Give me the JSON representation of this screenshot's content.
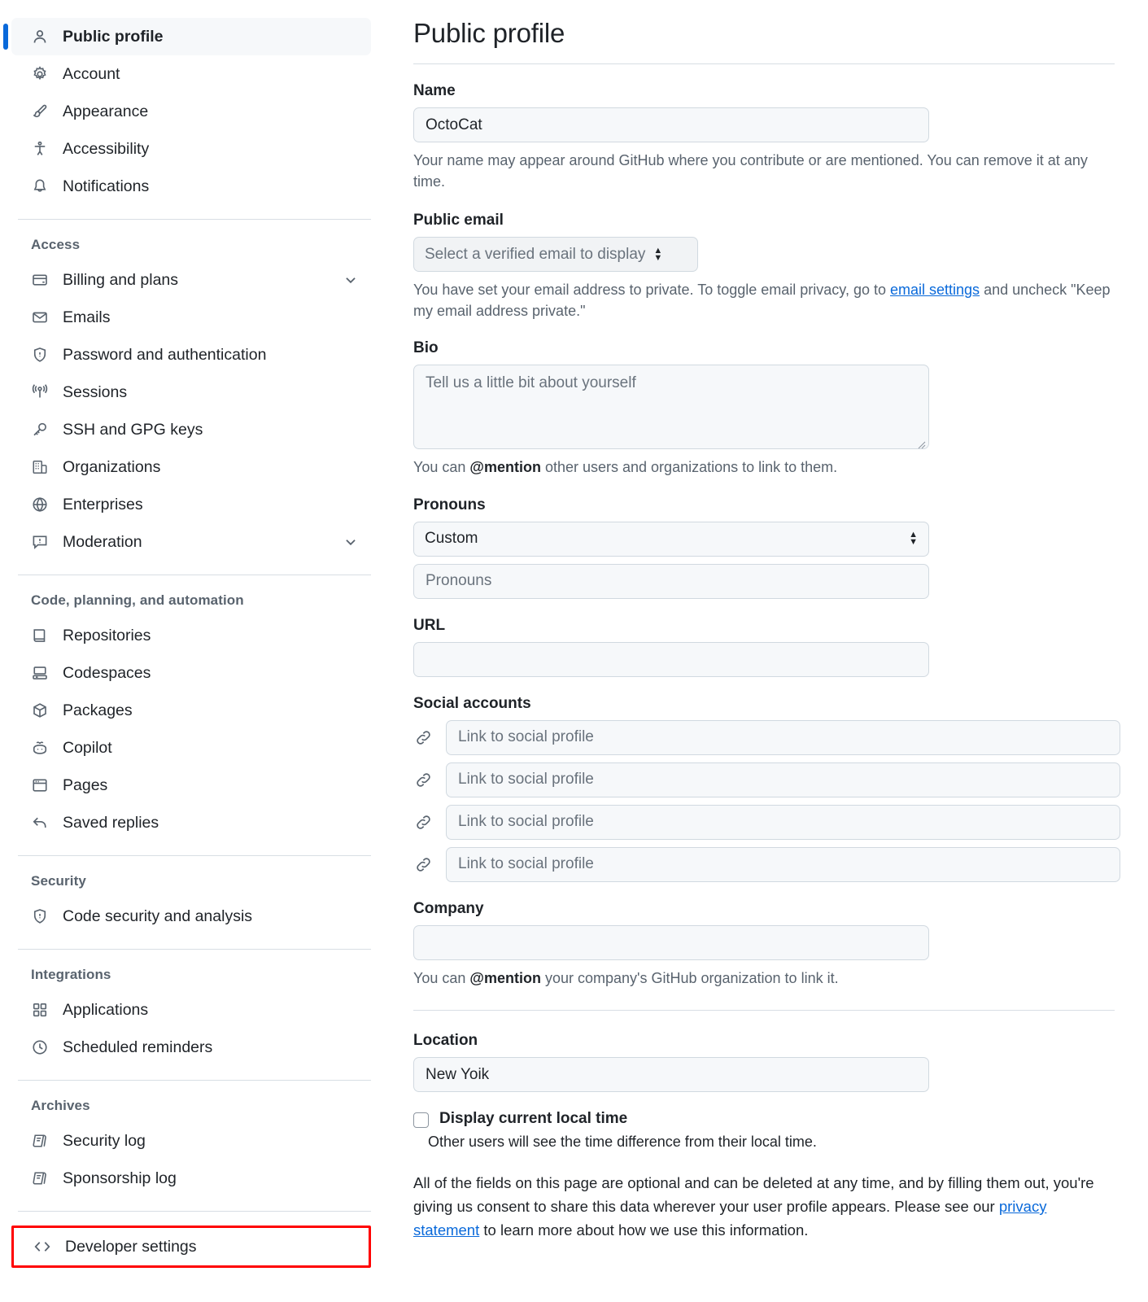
{
  "sidebar": {
    "groups": [
      {
        "title": null,
        "items": [
          {
            "label": "Public profile",
            "icon": "person-icon",
            "active": true,
            "chevron": false
          },
          {
            "label": "Account",
            "icon": "gear-icon",
            "active": false,
            "chevron": false
          },
          {
            "label": "Appearance",
            "icon": "paintbrush-icon",
            "active": false,
            "chevron": false
          },
          {
            "label": "Accessibility",
            "icon": "accessibility-icon",
            "active": false,
            "chevron": false
          },
          {
            "label": "Notifications",
            "icon": "bell-icon",
            "active": false,
            "chevron": false
          }
        ]
      },
      {
        "title": "Access",
        "items": [
          {
            "label": "Billing and plans",
            "icon": "credit-card-icon",
            "active": false,
            "chevron": true
          },
          {
            "label": "Emails",
            "icon": "mail-icon",
            "active": false,
            "chevron": false
          },
          {
            "label": "Password and authentication",
            "icon": "shield-lock-icon",
            "active": false,
            "chevron": false
          },
          {
            "label": "Sessions",
            "icon": "broadcast-icon",
            "active": false,
            "chevron": false
          },
          {
            "label": "SSH and GPG keys",
            "icon": "key-icon",
            "active": false,
            "chevron": false
          },
          {
            "label": "Organizations",
            "icon": "organization-icon",
            "active": false,
            "chevron": false
          },
          {
            "label": "Enterprises",
            "icon": "globe-icon",
            "active": false,
            "chevron": false
          },
          {
            "label": "Moderation",
            "icon": "report-icon",
            "active": false,
            "chevron": true
          }
        ]
      },
      {
        "title": "Code, planning, and automation",
        "items": [
          {
            "label": "Repositories",
            "icon": "repo-icon",
            "active": false,
            "chevron": false
          },
          {
            "label": "Codespaces",
            "icon": "codespaces-icon",
            "active": false,
            "chevron": false
          },
          {
            "label": "Packages",
            "icon": "package-icon",
            "active": false,
            "chevron": false
          },
          {
            "label": "Copilot",
            "icon": "copilot-icon",
            "active": false,
            "chevron": false
          },
          {
            "label": "Pages",
            "icon": "browser-icon",
            "active": false,
            "chevron": false
          },
          {
            "label": "Saved replies",
            "icon": "reply-icon",
            "active": false,
            "chevron": false
          }
        ]
      },
      {
        "title": "Security",
        "items": [
          {
            "label": "Code security and analysis",
            "icon": "shield-check-icon",
            "active": false,
            "chevron": false
          }
        ]
      },
      {
        "title": "Integrations",
        "items": [
          {
            "label": "Applications",
            "icon": "apps-icon",
            "active": false,
            "chevron": false
          },
          {
            "label": "Scheduled reminders",
            "icon": "clock-icon",
            "active": false,
            "chevron": false
          }
        ]
      },
      {
        "title": "Archives",
        "items": [
          {
            "label": "Security log",
            "icon": "log-icon",
            "active": false,
            "chevron": false
          },
          {
            "label": "Sponsorship log",
            "icon": "log-icon",
            "active": false,
            "chevron": false
          }
        ]
      }
    ],
    "developer_settings": {
      "label": "Developer settings",
      "icon": "code-icon",
      "highlight_color": "#ff0000"
    }
  },
  "main": {
    "page_title": "Public profile",
    "name": {
      "label": "Name",
      "value": "OctoCat",
      "help": "Your name may appear around GitHub where you contribute or are mentioned. You can remove it at any time."
    },
    "public_email": {
      "label": "Public email",
      "selected": "Select a verified email to display",
      "help_before": "You have set your email address to private. To toggle email privacy, go to ",
      "help_link": "email settings",
      "help_after": " and uncheck \"Keep my email address private.\""
    },
    "bio": {
      "label": "Bio",
      "value": "",
      "placeholder": "Tell us a little bit about yourself",
      "help_before": "You can ",
      "help_mention": "@mention",
      "help_after": " other users and organizations to link to them."
    },
    "pronouns": {
      "label": "Pronouns",
      "selected": "Custom",
      "custom_value": "",
      "custom_placeholder": "Pronouns"
    },
    "url": {
      "label": "URL",
      "value": ""
    },
    "social": {
      "label": "Social accounts",
      "rows": [
        {
          "value": "",
          "placeholder": "Link to social profile"
        },
        {
          "value": "",
          "placeholder": "Link to social profile"
        },
        {
          "value": "",
          "placeholder": "Link to social profile"
        },
        {
          "value": "",
          "placeholder": "Link to social profile"
        }
      ]
    },
    "company": {
      "label": "Company",
      "value": "",
      "help_before": "You can ",
      "help_mention": "@mention",
      "help_after": " your company's GitHub organization to link it."
    },
    "location": {
      "label": "Location",
      "value": "New Yoik"
    },
    "local_time": {
      "label": "Display current local time",
      "checked": false,
      "description": "Other users will see the time difference from their local time."
    },
    "footnote_before": "All of the fields on this page are optional and can be deleted at any time, and by filling them out, you're giving us consent to share this data wherever your user profile appears. Please see our ",
    "footnote_link": "privacy statement",
    "footnote_after": " to learn more about how we use this information."
  }
}
